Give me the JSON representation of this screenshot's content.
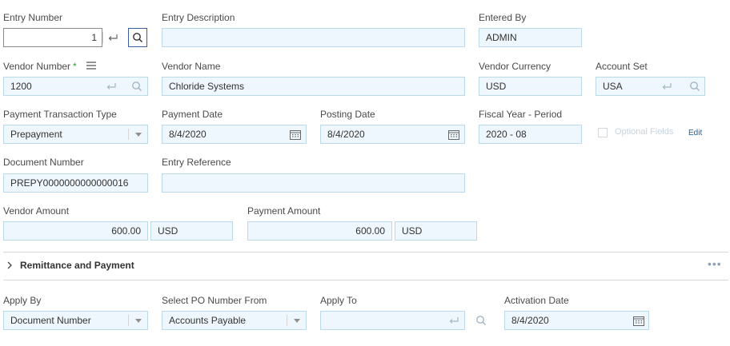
{
  "entry": {
    "number_label": "Entry Number",
    "number_value": "1",
    "description_label": "Entry Description",
    "description_value": "",
    "entered_by_label": "Entered By",
    "entered_by_value": "ADMIN"
  },
  "vendor": {
    "number_label": "Vendor Number",
    "required_mark": "*",
    "number_value": "1200",
    "name_label": "Vendor Name",
    "name_value": "Chloride Systems",
    "currency_label": "Vendor Currency",
    "currency_value": "USD",
    "account_set_label": "Account Set",
    "account_set_value": "USA"
  },
  "payment": {
    "transaction_type_label": "Payment Transaction Type",
    "transaction_type_value": "Prepayment",
    "payment_date_label": "Payment Date",
    "payment_date_value": "8/4/2020",
    "posting_date_label": "Posting Date",
    "posting_date_value": "8/4/2020",
    "fiscal_label": "Fiscal Year - Period",
    "fiscal_value": "2020 - 08",
    "optional_fields_label": "Optional Fields",
    "edit_label": "Edit"
  },
  "document": {
    "number_label": "Document Number",
    "number_value": "PREPY0000000000000016",
    "reference_label": "Entry Reference",
    "reference_value": ""
  },
  "amounts": {
    "vendor_amount_label": "Vendor Amount",
    "vendor_amount_value": "600.00",
    "vendor_amount_currency": "USD",
    "payment_amount_label": "Payment Amount",
    "payment_amount_value": "600.00",
    "payment_amount_currency": "USD"
  },
  "remittance": {
    "title": "Remittance and Payment",
    "more_label": "•••"
  },
  "apply": {
    "apply_by_label": "Apply By",
    "apply_by_value": "Document Number",
    "select_po_label": "Select PO Number From",
    "select_po_value": "Accounts Payable",
    "apply_to_label": "Apply To",
    "apply_to_value": "",
    "activation_date_label": "Activation Date",
    "activation_date_value": "8/4/2020"
  },
  "icons": {
    "enter": "enter-icon",
    "search": "search-icon",
    "calendar": "calendar-icon",
    "dropdown": "chevron-down-icon",
    "menu": "hamburger-icon",
    "expand": "chevron-right-icon"
  },
  "colors": {
    "field_bg": "#eef7fd",
    "field_border": "#bcd9ea",
    "link": "#1a5fa8",
    "required": "#2e9c3a"
  }
}
